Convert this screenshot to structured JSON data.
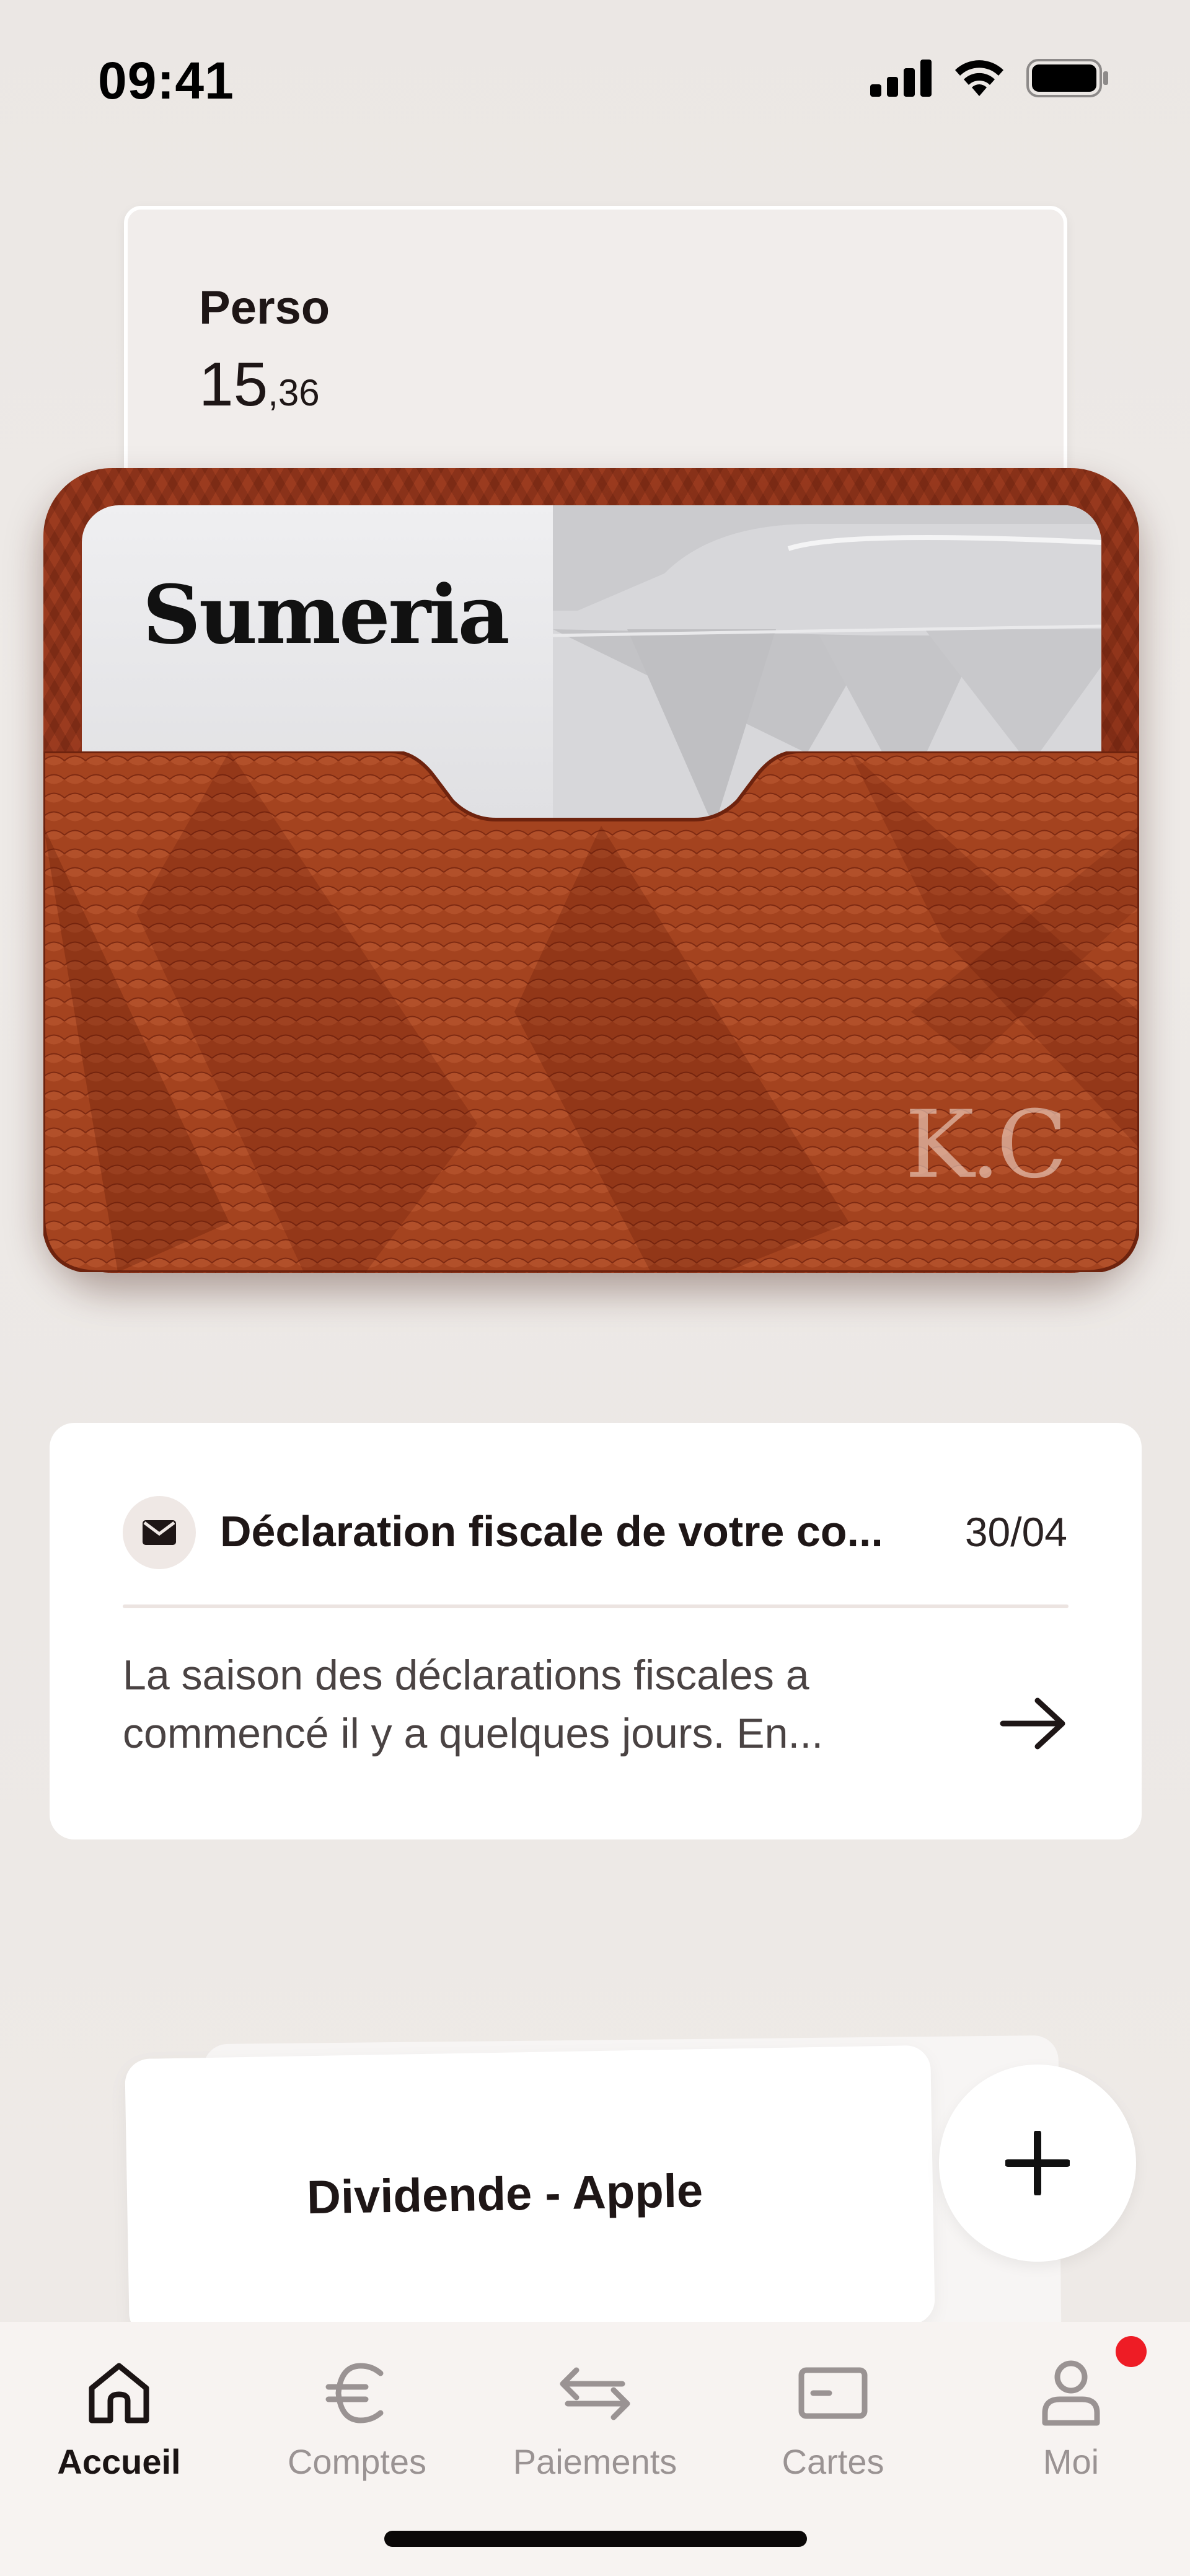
{
  "status_bar": {
    "time": "09:41",
    "icons": [
      "cellular-signal-icon",
      "wifi-icon",
      "battery-icon"
    ]
  },
  "account": {
    "name": "Perso",
    "balance_main": "15",
    "balance_cents": ",36"
  },
  "wallet": {
    "card_brand": "Sumeria",
    "monogram": "K.C",
    "leather_color": "#9b3b1f"
  },
  "message": {
    "icon": "mail-icon",
    "title": "Déclaration fiscale de votre co...",
    "date": "30/04",
    "body_line1": "La saison des déclarations fiscales a",
    "body_line2": "commencé il y a quelques jours. En..."
  },
  "transaction": {
    "title": "Dividende - Apple"
  },
  "add_button": {
    "icon": "plus-icon"
  },
  "tab_bar": {
    "items": [
      {
        "label": "Accueil",
        "icon": "home-icon",
        "active": true
      },
      {
        "label": "Comptes",
        "icon": "euro-icon",
        "active": false
      },
      {
        "label": "Paiements",
        "icon": "transfer-arrows-icon",
        "active": false
      },
      {
        "label": "Cartes",
        "icon": "card-icon",
        "active": false
      },
      {
        "label": "Moi",
        "icon": "user-icon",
        "active": false
      }
    ],
    "notification_color": "#ee1c25"
  }
}
